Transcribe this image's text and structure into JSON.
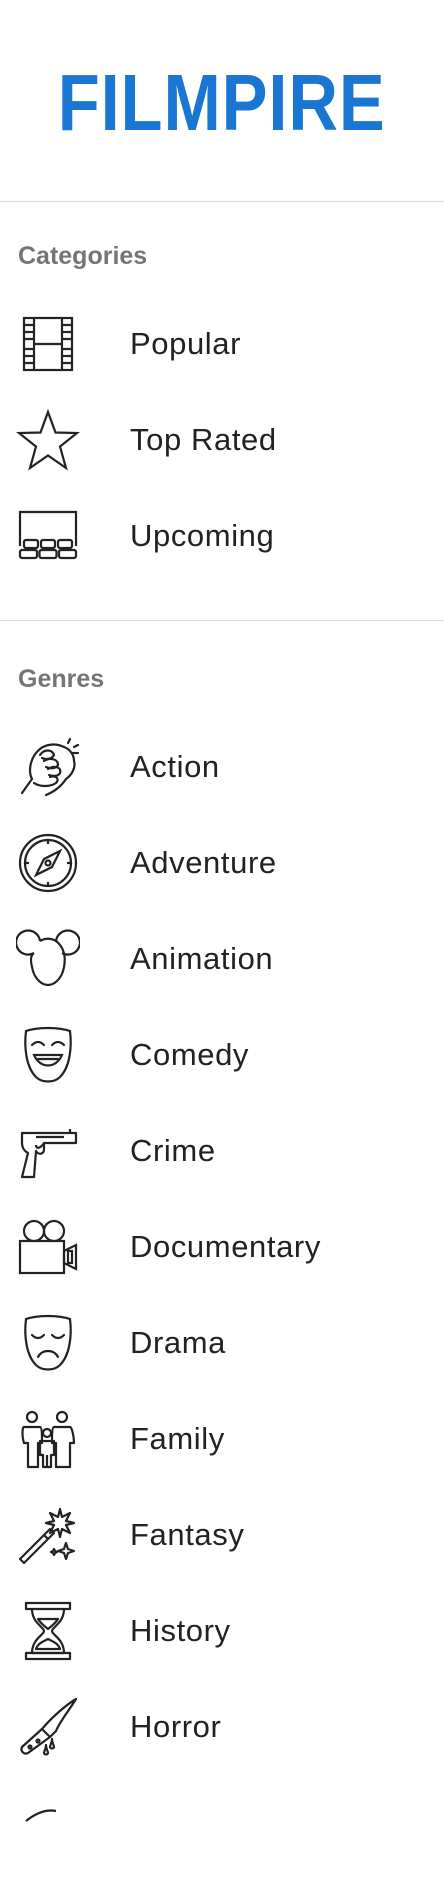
{
  "brand": {
    "name": "FILMPIRE",
    "color": "#1976d2"
  },
  "categories": {
    "title": "Categories",
    "items": [
      {
        "label": "Popular",
        "icon": "film-strip-icon"
      },
      {
        "label": "Top Rated",
        "icon": "star-icon"
      },
      {
        "label": "Upcoming",
        "icon": "cinema-screen-icon"
      }
    ]
  },
  "genres": {
    "title": "Genres",
    "items": [
      {
        "label": "Action",
        "icon": "fist-icon"
      },
      {
        "label": "Adventure",
        "icon": "compass-icon"
      },
      {
        "label": "Animation",
        "icon": "mouse-ears-icon"
      },
      {
        "label": "Comedy",
        "icon": "comedy-mask-icon"
      },
      {
        "label": "Crime",
        "icon": "pistol-icon"
      },
      {
        "label": "Documentary",
        "icon": "movie-camera-icon"
      },
      {
        "label": "Drama",
        "icon": "drama-mask-icon"
      },
      {
        "label": "Family",
        "icon": "family-icon"
      },
      {
        "label": "Fantasy",
        "icon": "magic-wand-icon"
      },
      {
        "label": "History",
        "icon": "hourglass-icon"
      },
      {
        "label": "Horror",
        "icon": "knife-icon"
      }
    ]
  }
}
